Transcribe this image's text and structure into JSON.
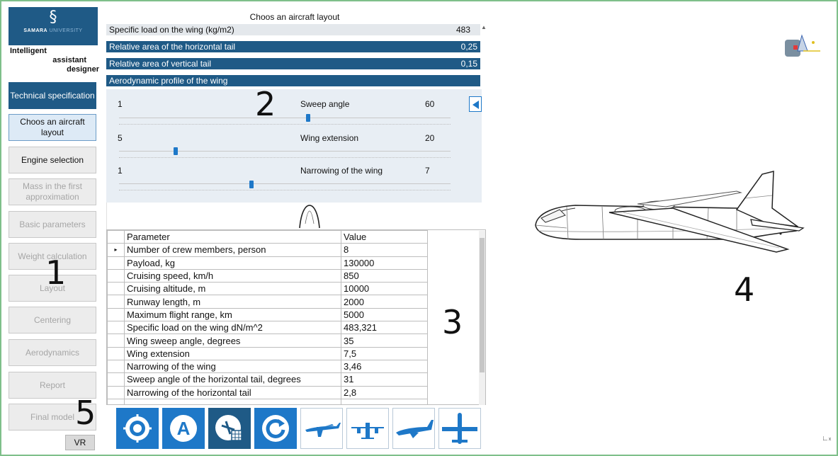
{
  "sidebar": {
    "logo": {
      "name": "SAMARA",
      "name_suffix": "UNIVERSITY"
    },
    "brand_line1": "Intelligent",
    "brand_line2": "assistant",
    "brand_line3": "designer",
    "items": [
      {
        "label": "Technical specification",
        "state": "active"
      },
      {
        "label": "Choos an aircraft layout",
        "state": "current"
      },
      {
        "label": "Engine selection",
        "state": "enabled"
      },
      {
        "label": "Mass in the first approximation",
        "state": "disabled"
      },
      {
        "label": "Basic parameters",
        "state": "disabled"
      },
      {
        "label": "Weight calculation",
        "state": "disabled"
      },
      {
        "label": "Layout",
        "state": "disabled"
      },
      {
        "label": "Centering",
        "state": "disabled"
      },
      {
        "label": "Aerodynamics",
        "state": "disabled"
      },
      {
        "label": "Report",
        "state": "disabled"
      },
      {
        "label": "Final model",
        "state": "disabled"
      }
    ],
    "vr_label": "VR"
  },
  "layout_panel": {
    "title": "Choos an aircraft layout",
    "rows": [
      {
        "label": "Specific load on the wing (kg/m2)",
        "value": "483"
      },
      {
        "label": "Relative area of the horizontal tail",
        "value": "0,25"
      },
      {
        "label": "Relative area of vertical tail",
        "value": "0,15"
      },
      {
        "label": "Aerodynamic profile of the wing",
        "value": ""
      }
    ],
    "sliders": [
      {
        "min": "1",
        "label": "Sweep angle",
        "value": "60",
        "position": 0.57
      },
      {
        "min": "5",
        "label": "Wing extension",
        "value": "20",
        "position": 0.17
      },
      {
        "min": "1",
        "label": "Narrowing of the wing",
        "value": "7",
        "position": 0.4
      }
    ]
  },
  "grid": {
    "headers": [
      "Parameter",
      "Value"
    ],
    "rows": [
      [
        "Number of crew members, person",
        "8"
      ],
      [
        "Payload, kg",
        "130000"
      ],
      [
        "Cruising speed, km/h",
        "850"
      ],
      [
        "Cruising altitude, m",
        "10000"
      ],
      [
        "Runway length, m",
        "2000"
      ],
      [
        "Maximum flight range, km",
        "5000"
      ],
      [
        "Specific load on the wing dN/m^2",
        "483,321"
      ],
      [
        "Wing sweep angle, degrees",
        "35"
      ],
      [
        "Wing extension",
        "7,5"
      ],
      [
        "Narrowing of the wing",
        "3,46"
      ],
      [
        "Sweep angle of the horizontal tail, degrees",
        "31"
      ],
      [
        "Narrowing of the horizontal tail",
        "2,8"
      ]
    ],
    "row_marker": "▸"
  },
  "toolbar": {
    "buttons": [
      {
        "icon": "target-icon"
      },
      {
        "icon": "letter-a-icon"
      },
      {
        "icon": "aircraft-table-icon"
      },
      {
        "icon": "refresh-icon"
      },
      {
        "icon": "high-wing-aircraft-icon"
      },
      {
        "icon": "turboprop-aircraft-icon"
      },
      {
        "icon": "business-jet-icon"
      },
      {
        "icon": "low-wing-aircraft-icon"
      }
    ]
  },
  "annotations": {
    "one": "1",
    "two": "2",
    "three": "3",
    "four": "4",
    "five": "5"
  },
  "view3d": {
    "coord_label": "x"
  },
  "colors": {
    "navy": "#1f5a86",
    "blue": "#1e78c8",
    "light_panel": "#e8eef4",
    "frame": "#7fbf8a"
  }
}
